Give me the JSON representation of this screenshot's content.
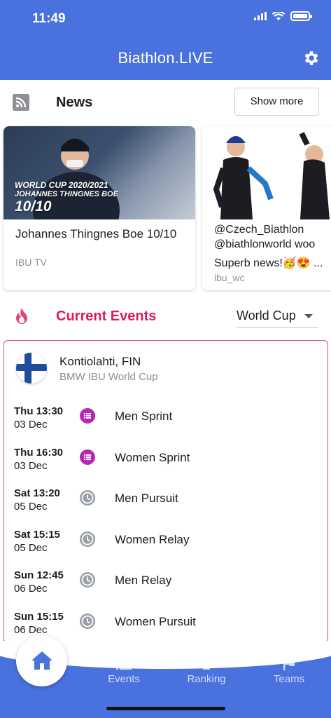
{
  "status": {
    "time": "11:49"
  },
  "header": {
    "title": "Biathlon.LIVE"
  },
  "news": {
    "title": "News",
    "show_more": "Show more",
    "cards": [
      {
        "thumb_line1": "WORLD CUP 2020/2021",
        "thumb_line2": "JOHANNES THINGNES BOE",
        "thumb_line3": "10/10",
        "title": "Johannes Thingnes Boe 10/10",
        "source": "IBU TV"
      },
      {
        "line1": "@Czech_Biathlon",
        "line2": "@biathlonworld woo",
        "line3": "Superb news!🥳😍 ...",
        "source": "ibu_wc"
      }
    ]
  },
  "events": {
    "title": "Current Events",
    "filter": "World Cup",
    "location": "Kontiolahti, FIN",
    "series": "BMW IBU World Cup",
    "races": [
      {
        "day": "Thu 13:30",
        "date": "03 Dec",
        "name": "Men Sprint",
        "icon": "list-icon"
      },
      {
        "day": "Thu 16:30",
        "date": "03 Dec",
        "name": "Women Sprint",
        "icon": "list-icon"
      },
      {
        "day": "Sat 13:20",
        "date": "05 Dec",
        "name": "Men Pursuit",
        "icon": "clock-icon"
      },
      {
        "day": "Sat 15:15",
        "date": "05 Dec",
        "name": "Women Relay",
        "icon": "clock-icon"
      },
      {
        "day": "Sun 12:45",
        "date": "06 Dec",
        "name": "Men Relay",
        "icon": "clock-icon"
      },
      {
        "day": "Sun 15:15",
        "date": "06 Dec",
        "name": "Women Pursuit",
        "icon": "clock-icon"
      }
    ]
  },
  "tabs": {
    "events": "Events",
    "ranking": "Ranking",
    "teams": "Teams"
  },
  "colors": {
    "primary": "#4a72df",
    "accent": "#d81b60"
  }
}
